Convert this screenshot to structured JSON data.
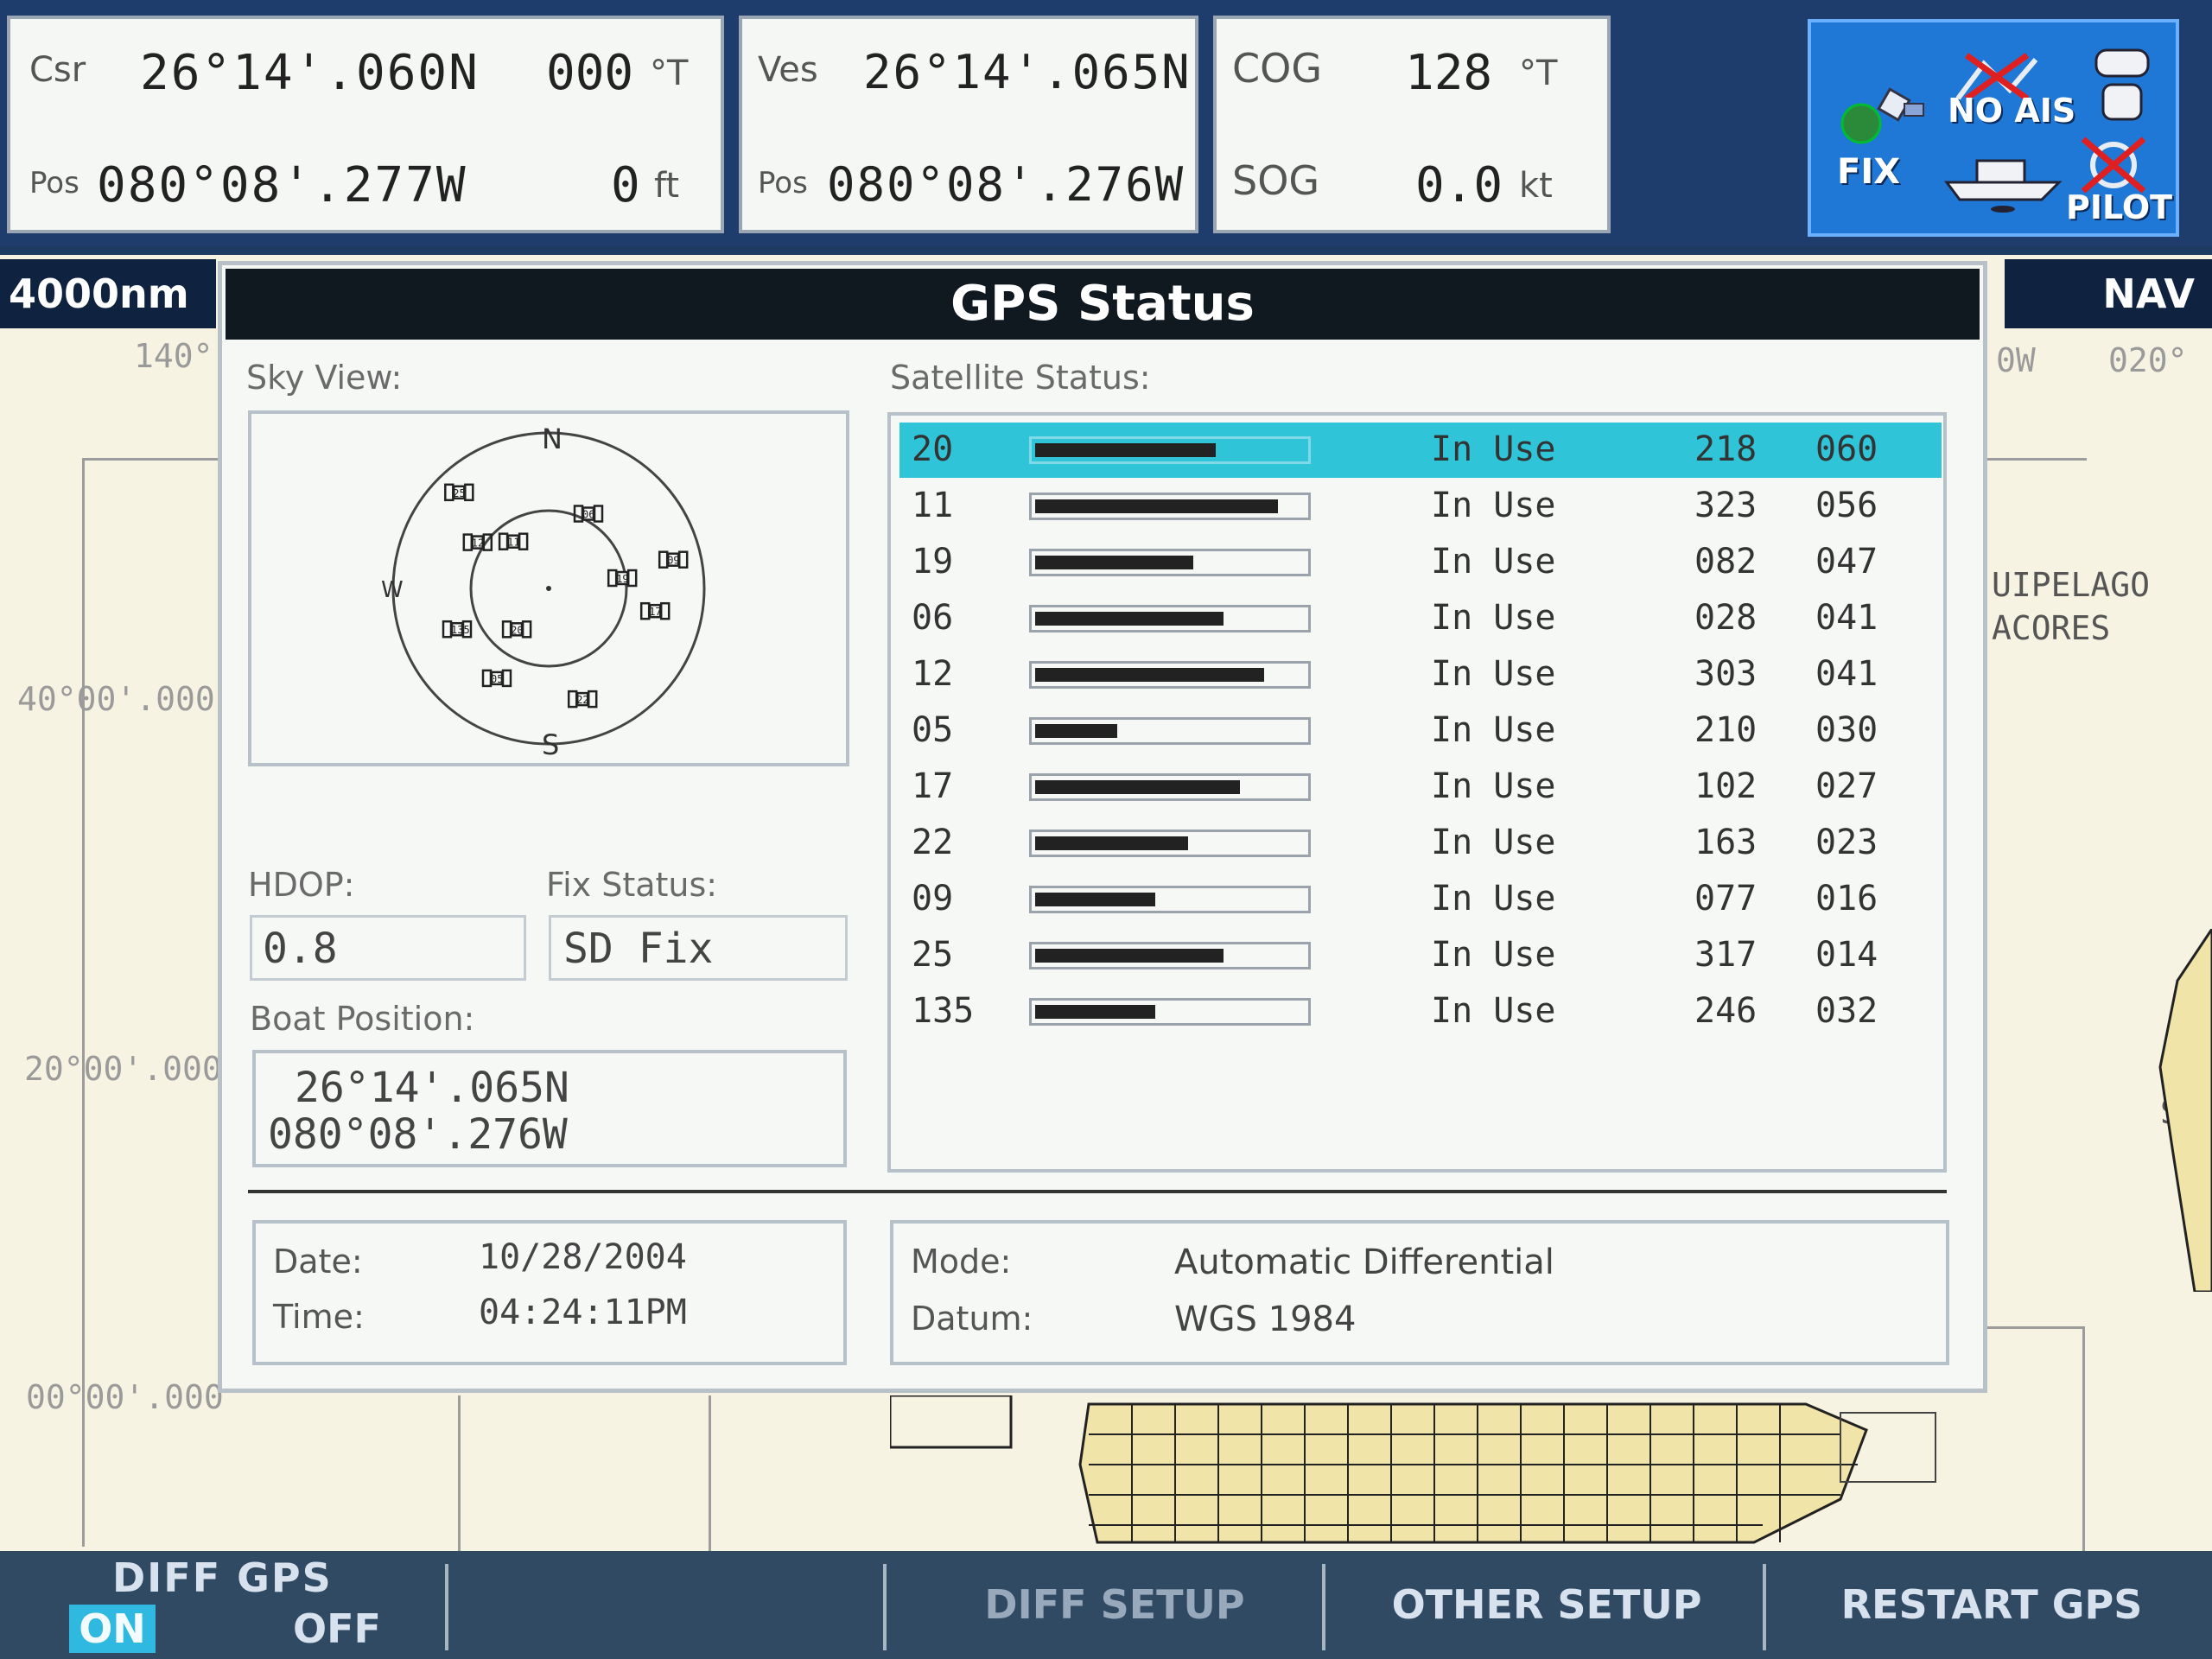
{
  "topbar": {
    "csr": {
      "label": "Csr",
      "lat": "26°14'.060N",
      "bearing": "000",
      "bearing_unit": "°T",
      "pos_label": "Pos",
      "lon": "080°08'.277W",
      "range": "0",
      "range_unit": "ft"
    },
    "ves": {
      "label": "Ves",
      "lat": "26°14'.065N",
      "pos_label": "Pos",
      "lon": "080°08'.276W"
    },
    "cog": {
      "label": "COG",
      "value": "128",
      "unit": "°T"
    },
    "sog": {
      "label": "SOG",
      "value": "0.0",
      "unit": "kt"
    },
    "status": {
      "fix": "FIX",
      "no_ais": "NO AIS",
      "pilot": "PILOT"
    }
  },
  "chart": {
    "scale": "4000nm",
    "mode": "NAV",
    "labels": [
      "140°",
      "40°00'.000",
      "20°00'.000",
      "00°00'.000",
      "0W",
      "020°",
      "UIPELAGO",
      "ACORES",
      "SE"
    ]
  },
  "dialog": {
    "title": "GPS Status",
    "sky_view_label": "Sky View:",
    "sky": {
      "n": "N",
      "s": "S",
      "w": "W"
    },
    "sky_sats": [
      {
        "id": "20",
        "az": 218,
        "el": 60
      },
      {
        "id": "11",
        "az": 323,
        "el": 56
      },
      {
        "id": "19",
        "az": 82,
        "el": 47
      },
      {
        "id": "06",
        "az": 28,
        "el": 41
      },
      {
        "id": "12",
        "az": 303,
        "el": 41
      },
      {
        "id": "05",
        "az": 210,
        "el": 30
      },
      {
        "id": "17",
        "az": 102,
        "el": 27
      },
      {
        "id": "22",
        "az": 163,
        "el": 23
      },
      {
        "id": "09",
        "az": 77,
        "el": 16
      },
      {
        "id": "25",
        "az": 317,
        "el": 14
      },
      {
        "id": "135",
        "az": 246,
        "el": 32
      }
    ],
    "satellite_status_label": "Satellite Status:",
    "hdop_label": "HDOP:",
    "hdop": "0.8",
    "fix_status_label": "Fix Status:",
    "fix_status": "SD Fix",
    "boat_position_label": "Boat Position:",
    "boat_lat": "26°14'.065N",
    "boat_lon": "080°08'.276W",
    "date_label": "Date:",
    "date": "10/28/2004",
    "time_label": "Time:",
    "time": "04:24:11PM",
    "mode_label": "Mode:",
    "mode": "Automatic Differential",
    "datum_label": "Datum:",
    "datum": "WGS 1984",
    "satellites": [
      {
        "prn": "20",
        "signal": 0.66,
        "status": "In Use",
        "azimuth": "218",
        "elevation": "060",
        "selected": true
      },
      {
        "prn": "11",
        "signal": 0.89,
        "status": "In Use",
        "azimuth": "323",
        "elevation": "056"
      },
      {
        "prn": "19",
        "signal": 0.58,
        "status": "In Use",
        "azimuth": "082",
        "elevation": "047"
      },
      {
        "prn": "06",
        "signal": 0.69,
        "status": "In Use",
        "azimuth": "028",
        "elevation": "041"
      },
      {
        "prn": "12",
        "signal": 0.84,
        "status": "In Use",
        "azimuth": "303",
        "elevation": "041"
      },
      {
        "prn": "05",
        "signal": 0.3,
        "status": "In Use",
        "azimuth": "210",
        "elevation": "030"
      },
      {
        "prn": "17",
        "signal": 0.75,
        "status": "In Use",
        "azimuth": "102",
        "elevation": "027"
      },
      {
        "prn": "22",
        "signal": 0.56,
        "status": "In Use",
        "azimuth": "163",
        "elevation": "023"
      },
      {
        "prn": "09",
        "signal": 0.44,
        "status": "In Use",
        "azimuth": "077",
        "elevation": "016"
      },
      {
        "prn": "25",
        "signal": 0.69,
        "status": "In Use",
        "azimuth": "317",
        "elevation": "014"
      },
      {
        "prn": "135",
        "signal": 0.44,
        "status": "In Use",
        "azimuth": "246",
        "elevation": "032"
      }
    ]
  },
  "softkeys": {
    "diff_gps": "DIFF GPS",
    "on": "ON",
    "off": "OFF",
    "diff_setup": "DIFF SETUP",
    "other_setup": "OTHER SETUP",
    "restart_gps": "RESTART GPS"
  },
  "colors": {
    "selected_row": "#2fc4d8",
    "fix_panel": "#1f78d6",
    "on_highlight": "#2fb8e0"
  }
}
